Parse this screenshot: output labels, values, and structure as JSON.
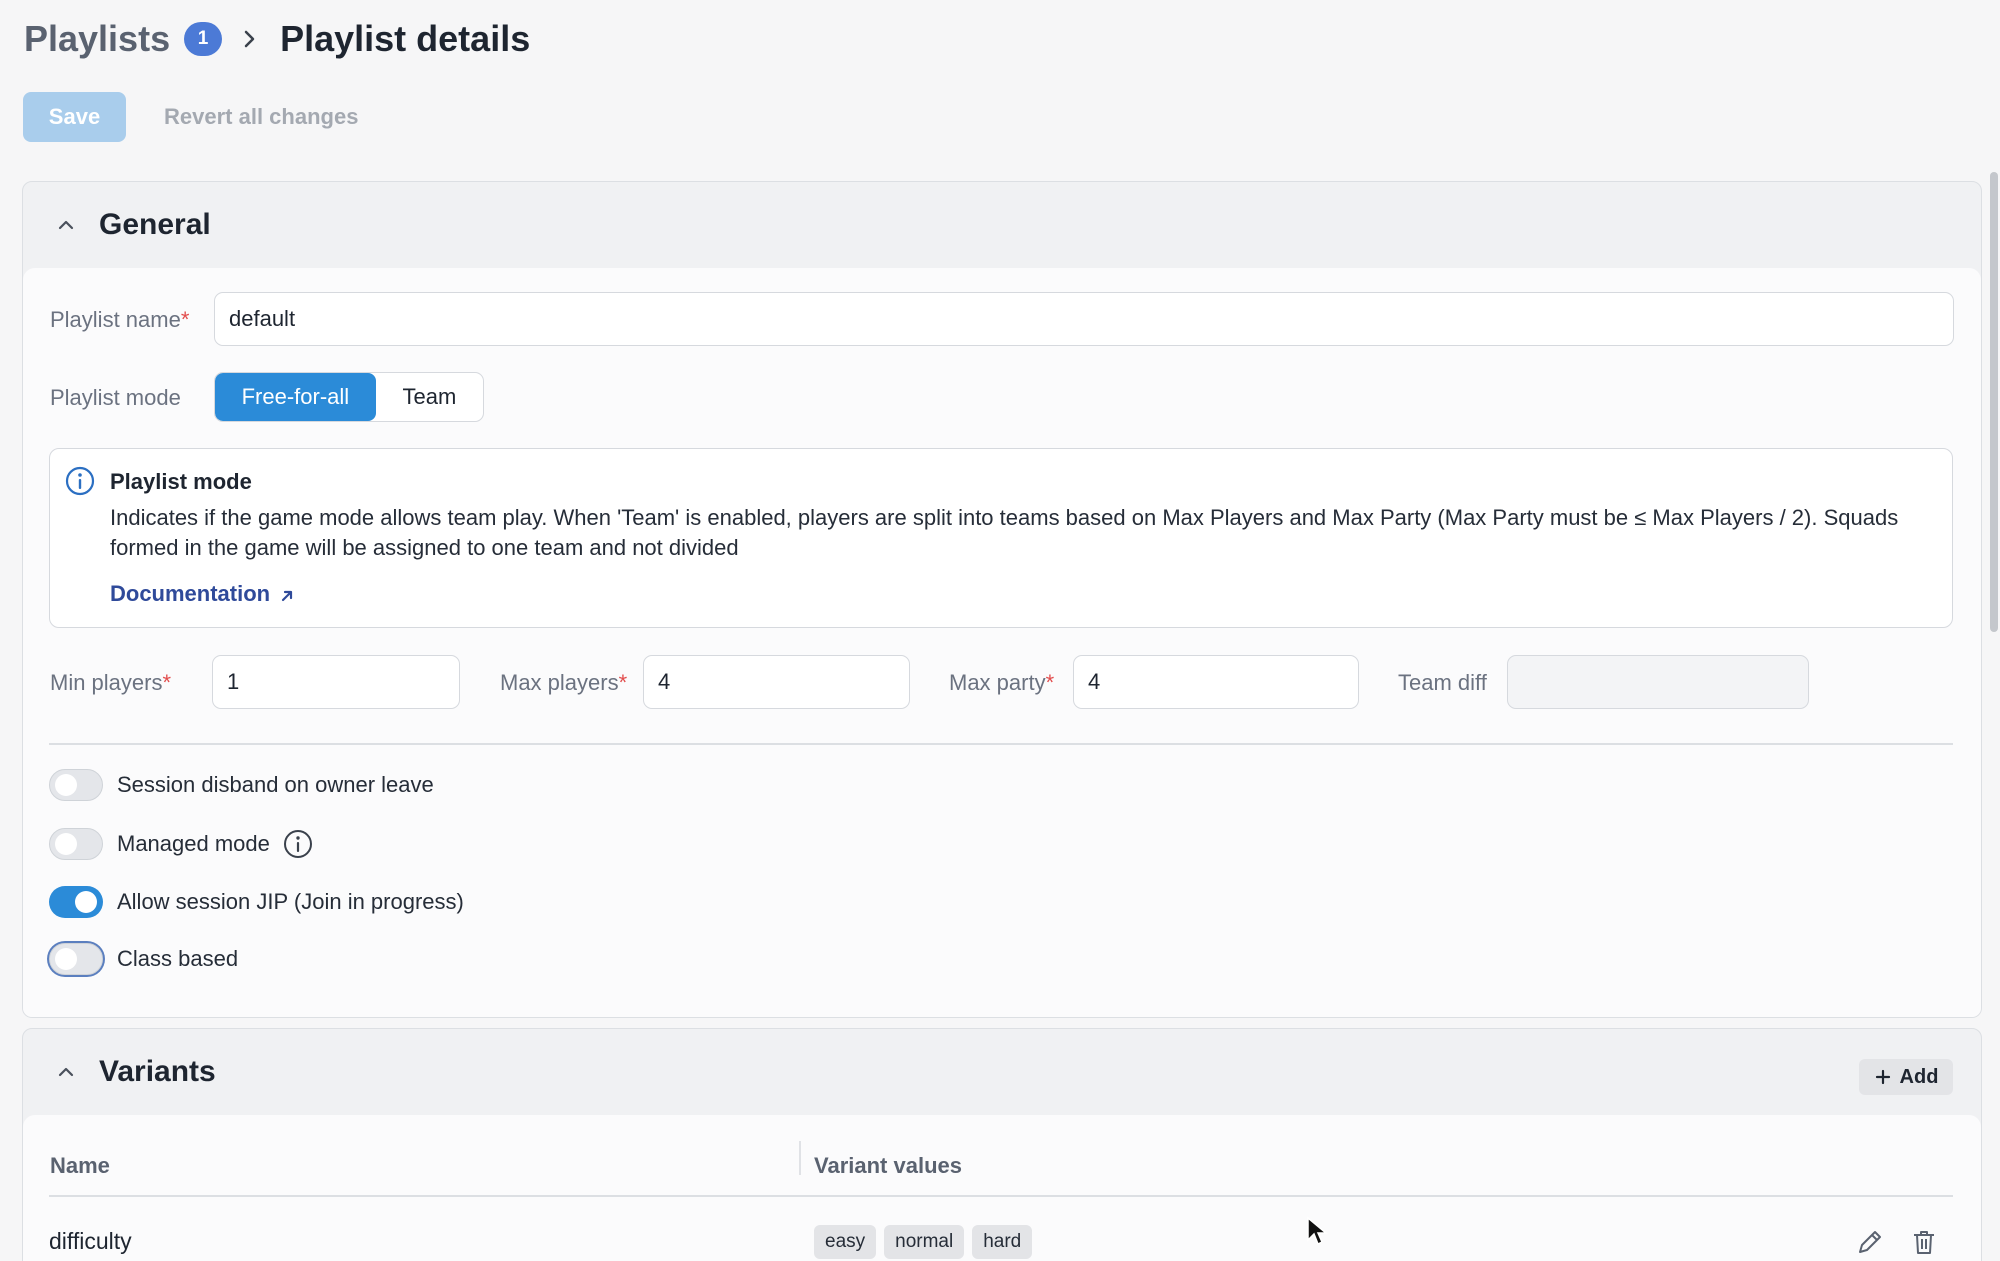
{
  "header": {
    "root": "Playlists",
    "badge": "1",
    "title": "Playlist details"
  },
  "actions": {
    "save": "Save",
    "revert": "Revert all changes"
  },
  "general": {
    "title": "General",
    "playlist_name": {
      "label": "Playlist name",
      "required": "*",
      "value": "default"
    },
    "playlist_mode": {
      "label": "Playlist mode",
      "options": [
        "Free-for-all",
        "Team"
      ],
      "selected": "Free-for-all"
    },
    "info": {
      "title": "Playlist mode",
      "text": "Indicates if the game mode allows team play. When 'Team' is enabled, players are split into teams based on Max Players and Max Party (Max Party must be ≤ Max Players / 2). Squads formed in the game will be assigned to one team and not divided",
      "link": "Documentation"
    },
    "min_players": {
      "label": "Min players",
      "required": "*",
      "value": "1"
    },
    "max_players": {
      "label": "Max players",
      "required": "*",
      "value": "4"
    },
    "max_party": {
      "label": "Max party",
      "required": "*",
      "value": "4"
    },
    "team_diff": {
      "label": "Team diff",
      "value": ""
    },
    "toggles": [
      {
        "label": "Session disband on owner leave",
        "on": false
      },
      {
        "label": "Managed mode",
        "on": false
      },
      {
        "label": "Allow session JIP (Join in progress)",
        "on": true
      },
      {
        "label": "Class based",
        "on": false
      }
    ]
  },
  "variants": {
    "title": "Variants",
    "add": "Add",
    "columns": [
      "Name",
      "Variant values"
    ],
    "rows": [
      {
        "name": "difficulty",
        "values": [
          "easy",
          "normal",
          "hard"
        ]
      }
    ]
  },
  "colors": {
    "accent": "#2b8bd8",
    "badge": "#4c7ad6",
    "link": "#2f4a9a",
    "required": "#e24d4d"
  }
}
